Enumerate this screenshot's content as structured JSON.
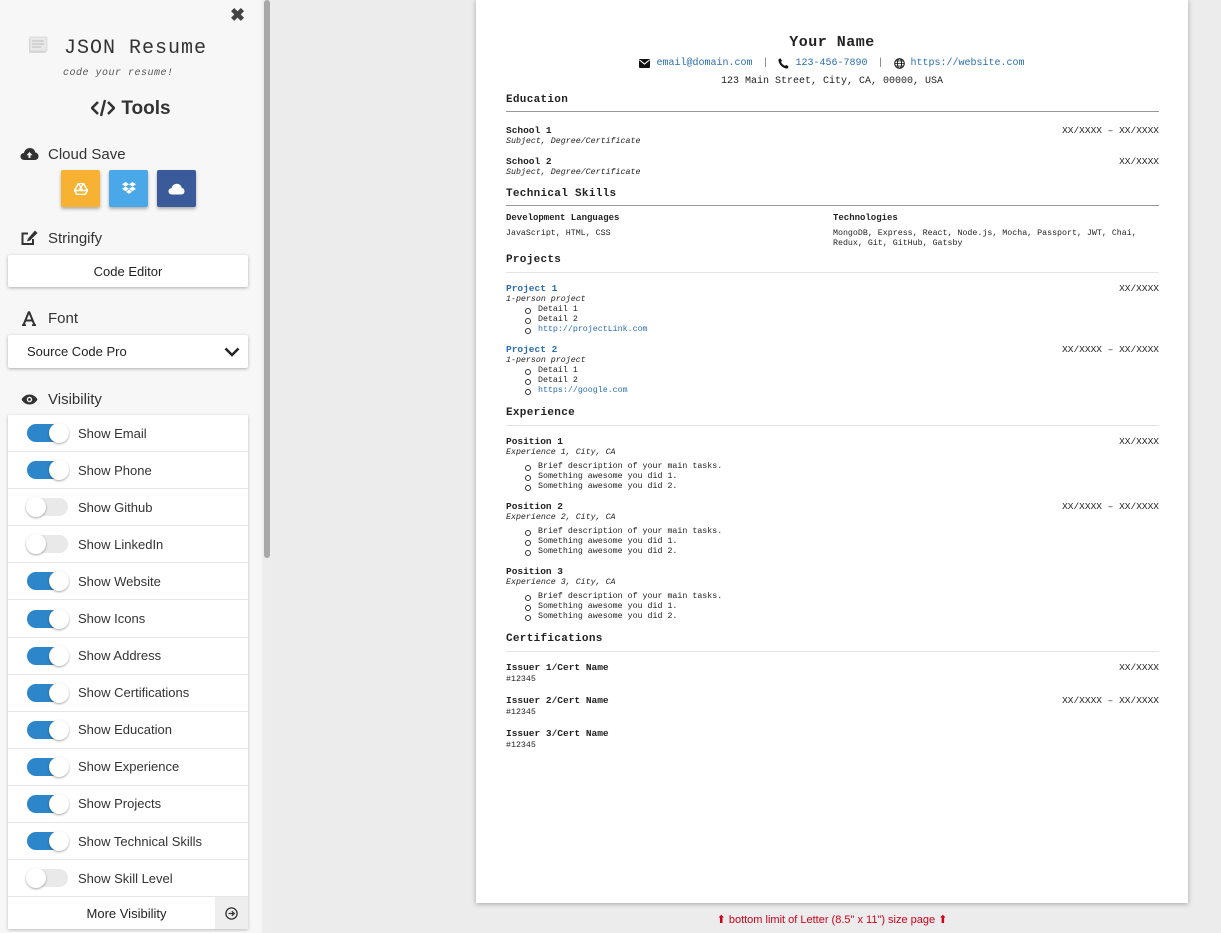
{
  "sidebar": {
    "close": "✖",
    "logo_title": "JSON Resume",
    "logo_subtitle": "code your resume!",
    "tools_title": "Tools",
    "cloud_save": {
      "label": "Cloud Save",
      "buttons": [
        {
          "name": "Google Drive",
          "color": "#f7b234"
        },
        {
          "name": "Dropbox",
          "color": "#4aa7e8"
        },
        {
          "name": "Cloud",
          "color": "#3a5a99"
        }
      ]
    },
    "stringify": {
      "label": "Stringify",
      "button": "Code Editor"
    },
    "font": {
      "label": "Font",
      "selected": "Source Code Pro"
    },
    "visibility": {
      "label": "Visibility",
      "items": [
        {
          "label": "Show Email",
          "on": true
        },
        {
          "label": "Show Phone",
          "on": true
        },
        {
          "label": "Show Github",
          "on": false
        },
        {
          "label": "Show LinkedIn",
          "on": false
        },
        {
          "label": "Show Website",
          "on": true
        },
        {
          "label": "Show Icons",
          "on": true
        },
        {
          "label": "Show Address",
          "on": true
        },
        {
          "label": "Show Certifications",
          "on": true
        },
        {
          "label": "Show Education",
          "on": true
        },
        {
          "label": "Show Experience",
          "on": true
        },
        {
          "label": "Show Projects",
          "on": true
        },
        {
          "label": "Show Technical Skills",
          "on": true
        },
        {
          "label": "Show Skill Level",
          "on": false
        }
      ],
      "more": "More Visibility"
    }
  },
  "resume": {
    "name": "Your Name",
    "email": "email@domain.com",
    "phone": "123-456-7890",
    "website": "https://website.com",
    "separator": "|",
    "address": "123 Main Street, City, CA, 00000, USA",
    "education": {
      "title": "Education",
      "items": [
        {
          "school": "School 1",
          "degree": "Subject, Degree/Certificate",
          "date": "XX/XXXX – XX/XXXX"
        },
        {
          "school": "School 2",
          "degree": "Subject, Degree/Certificate",
          "date": "XX/XXXX"
        }
      ]
    },
    "skills": {
      "title": "Technical Skills",
      "columns": [
        {
          "heading": "Development Languages",
          "text": "JavaScript, HTML, CSS"
        },
        {
          "heading": "Technologies",
          "text": "MongoDB, Express, React, Node.js, Mocha, Passport, JWT, Chai, Redux, Git, GitHub, Gatsby"
        }
      ]
    },
    "projects": {
      "title": "Projects",
      "items": [
        {
          "name": "Project 1",
          "subtitle": "1-person project",
          "date": "XX/XXXX",
          "details": [
            "Detail 1",
            "Detail 2"
          ],
          "link": "http://projectLink.com"
        },
        {
          "name": "Project 2",
          "subtitle": "1-person project",
          "date": "XX/XXXX – XX/XXXX",
          "details": [
            "Detail 1",
            "Detail 2"
          ],
          "link": "https://google.com"
        }
      ]
    },
    "experience": {
      "title": "Experience",
      "items": [
        {
          "position": "Position 1",
          "company": "Experience 1, City, CA",
          "date": "XX/XXXX",
          "bullets": [
            "Brief description of your main tasks.",
            "Something awesome you did 1.",
            "Something awesome you did 2."
          ]
        },
        {
          "position": "Position 2",
          "company": "Experience 2, City, CA",
          "date": "XX/XXXX – XX/XXXX",
          "bullets": [
            "Brief description of your main tasks.",
            "Something awesome you did 1.",
            "Something awesome you did 2."
          ]
        },
        {
          "position": "Position 3",
          "company": "Experience 3, City, CA",
          "date": "",
          "bullets": [
            "Brief description of your main tasks.",
            "Something awesome you did 1.",
            "Something awesome you did 2."
          ]
        }
      ]
    },
    "certifications": {
      "title": "Certifications",
      "items": [
        {
          "name": "Issuer 1/Cert Name",
          "id": "#12345",
          "date": "XX/XXXX"
        },
        {
          "name": "Issuer 2/Cert Name",
          "id": "#12345",
          "date": "XX/XXXX – XX/XXXX"
        },
        {
          "name": "Issuer 3/Cert Name",
          "id": "#12345",
          "date": ""
        }
      ]
    }
  },
  "bottom_note": "⬆ bottom limit of Letter (8.5\" x 11\") size page ⬆"
}
